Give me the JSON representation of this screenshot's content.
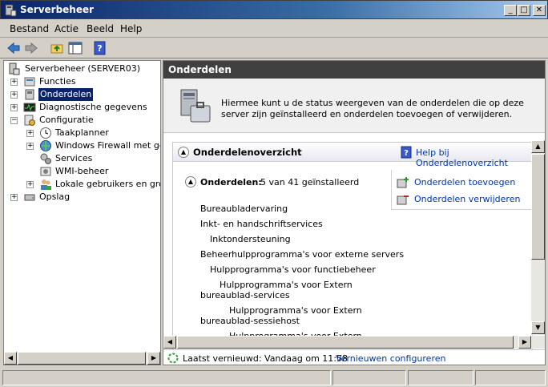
{
  "window": {
    "title": "Serverbeheer",
    "min_label": "_",
    "max_label": "□",
    "close_label": "✕"
  },
  "menu": [
    "Bestand",
    "Actie",
    "Beeld",
    "Help"
  ],
  "tree": {
    "root": "Serverbeheer (SERVER03)",
    "items": [
      {
        "label": "Functies"
      },
      {
        "label": "Onderdelen",
        "selected": true
      },
      {
        "label": "Diagnostische gegevens"
      },
      {
        "label": "Configuratie"
      },
      {
        "label": "Taakplanner"
      },
      {
        "label": "Windows Firewall met geav"
      },
      {
        "label": "Services"
      },
      {
        "label": "WMI-beheer"
      },
      {
        "label": "Lokale gebruikers en groepe"
      },
      {
        "label": "Opslag"
      }
    ]
  },
  "right": {
    "header": "Onderdelen",
    "intro_text": "Hiermee kunt u de status weergeven van de onderdelen die op deze server zijn geïnstalleerd en onderdelen toevoegen of verwijderen.",
    "section_title": "Onderdelenoverzicht",
    "help_link": "Help bij Onderdelenoverzicht",
    "features_label": "Onderdelen:",
    "features_count": "5 van 41 geïnstalleerd",
    "add_link": "Onderdelen toevoegen",
    "remove_link": "Onderdelen verwijderen",
    "installed": [
      "Bureaubladervaring",
      "Inkt- en handschriftservices",
      "Inktondersteuning",
      "Beheerhulpprogramma's voor externe servers",
      "Hulpprogramma's voor functiebeheer",
      "Hulpprogramma's voor Extern",
      "bureaublad-services",
      "Hulpprogramma's voor Extern",
      "bureaublad-sessiehost",
      "Hulpprogramma's voor Extern"
    ],
    "last_refresh": "Laatst vernieuwd: Vandaag om 11:58",
    "configure_link": "Vernieuwen configureren"
  },
  "colors": {
    "titlebar": "#0a246a",
    "header": "#404040",
    "link": "#0033aa",
    "selection": "#0a246a"
  }
}
